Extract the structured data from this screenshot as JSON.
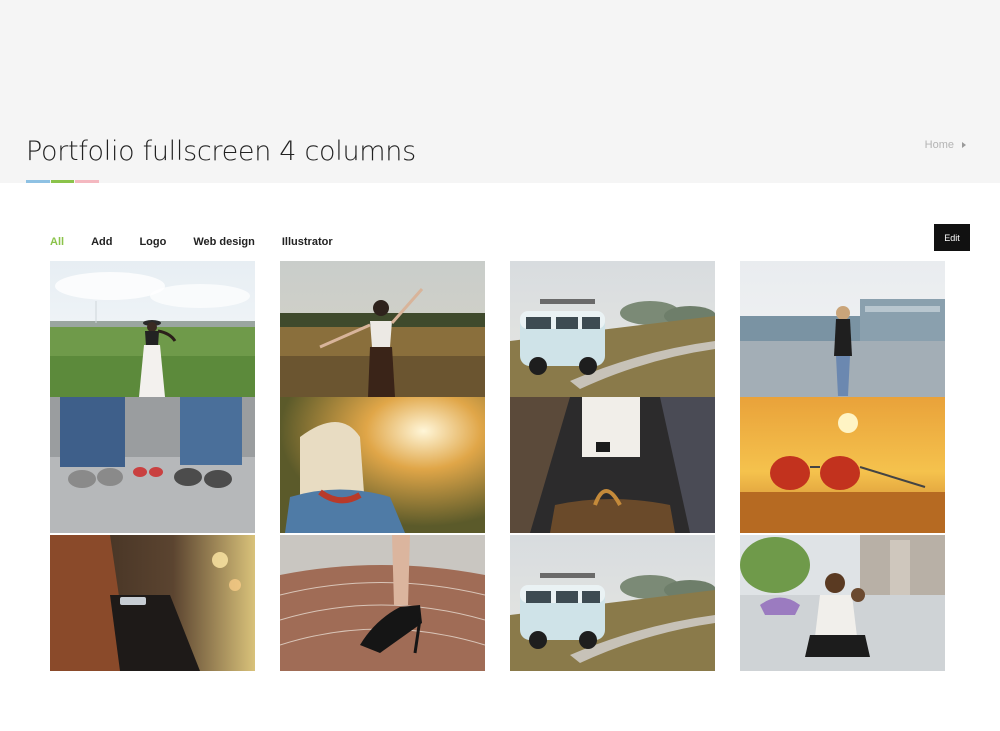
{
  "header": {
    "title": "Portfolio fullscreen 4 columns",
    "underline_colors": [
      "#8ec1e3",
      "#8bc34a",
      "#f4b8c0"
    ],
    "breadcrumb": "Home"
  },
  "filters": {
    "items": [
      "All",
      "Add",
      "Logo",
      "Web design",
      "Illustrator"
    ],
    "active": "All",
    "active_color": "#8bc34a"
  },
  "edit_button": {
    "label": "Edit"
  },
  "portfolio": {
    "items": [
      "woman-in-meadow-with-hat",
      "woman-dancing-in-field",
      "vintage-van-on-road",
      "woman-in-parking-lot",
      "jeans-and-sneakers-family",
      "blonde-woman-sunlight",
      "escalator-handbag",
      "sunglasses-at-sunset",
      "person-with-phone",
      "high-heel-shoe-on-pavement",
      "vintage-van-on-road-repeat",
      "mother-and-child-on-street"
    ]
  }
}
